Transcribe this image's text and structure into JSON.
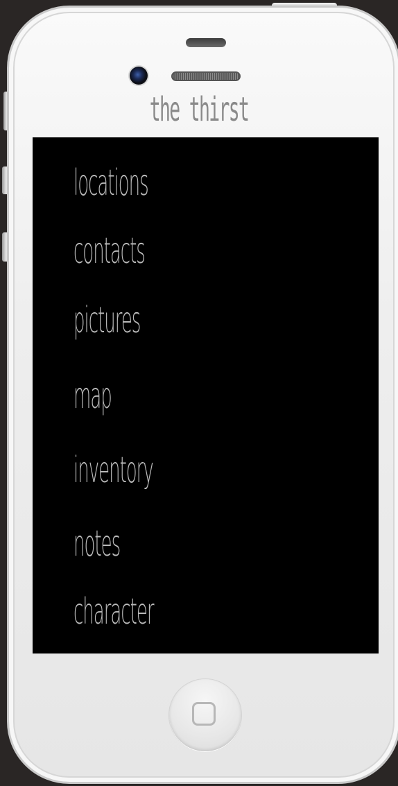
{
  "app": {
    "title": "the thirst"
  },
  "menu": {
    "items": [
      {
        "label": "locations"
      },
      {
        "label": "contacts"
      },
      {
        "label": "pictures"
      },
      {
        "label": "map"
      },
      {
        "label": "inventory"
      },
      {
        "label": "notes"
      },
      {
        "label": "character"
      }
    ]
  },
  "colors": {
    "screen_background": "#000000",
    "menu_text": "#b9b9b9",
    "title_text": "#8a8a8a",
    "device_body": "#eeeeee",
    "page_background": "#2a2625"
  },
  "icons": {
    "home_button": "home-square-icon",
    "camera": "front-camera-icon",
    "speaker": "earpiece-speaker-icon"
  }
}
